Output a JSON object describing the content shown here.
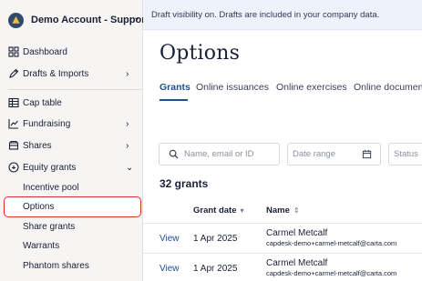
{
  "account": {
    "name": "Demo Account - Support"
  },
  "sidebar": {
    "items": [
      {
        "label": "Dashboard",
        "icon": "dashboard-icon"
      },
      {
        "label": "Drafts & Imports",
        "icon": "pen-icon"
      },
      {
        "label": "Cap table",
        "icon": "table-icon"
      },
      {
        "label": "Fundraising",
        "icon": "chart-icon"
      },
      {
        "label": "Shares",
        "icon": "shares-icon"
      },
      {
        "label": "Equity grants",
        "icon": "equity-icon"
      }
    ],
    "sub_items": [
      {
        "label": "Incentive pool"
      },
      {
        "label": "Options"
      },
      {
        "label": "Share grants"
      },
      {
        "label": "Warrants"
      },
      {
        "label": "Phantom shares"
      }
    ]
  },
  "banner": {
    "text": "Draft visibility on. Drafts are included in your company data."
  },
  "page": {
    "title": "Options"
  },
  "tabs": [
    {
      "label": "Grants"
    },
    {
      "label": "Online issuances"
    },
    {
      "label": "Online exercises"
    },
    {
      "label": "Online documen"
    }
  ],
  "filters": {
    "search_placeholder": "Name, email or ID",
    "date_placeholder": "Date range",
    "status_placeholder": "Status"
  },
  "grants": {
    "count_label": "32 grants",
    "columns": {
      "grant_date": "Grant date",
      "name": "Name"
    },
    "rows": [
      {
        "action": "View",
        "date": "1 Apr 2025",
        "name": "Carmel Metcalf",
        "email": "capdesk-demo+carmel-metcalf@carta.com"
      },
      {
        "action": "View",
        "date": "1 Apr 2025",
        "name": "Carmel Metcalf",
        "email": "capdesk-demo+carmel-metcalf@carta.com"
      }
    ]
  },
  "colors": {
    "accent": "#1d4f91",
    "highlight": "#d9342b",
    "sidebar_bg": "#f6f5f3",
    "banner_bg": "#eef3fb"
  }
}
